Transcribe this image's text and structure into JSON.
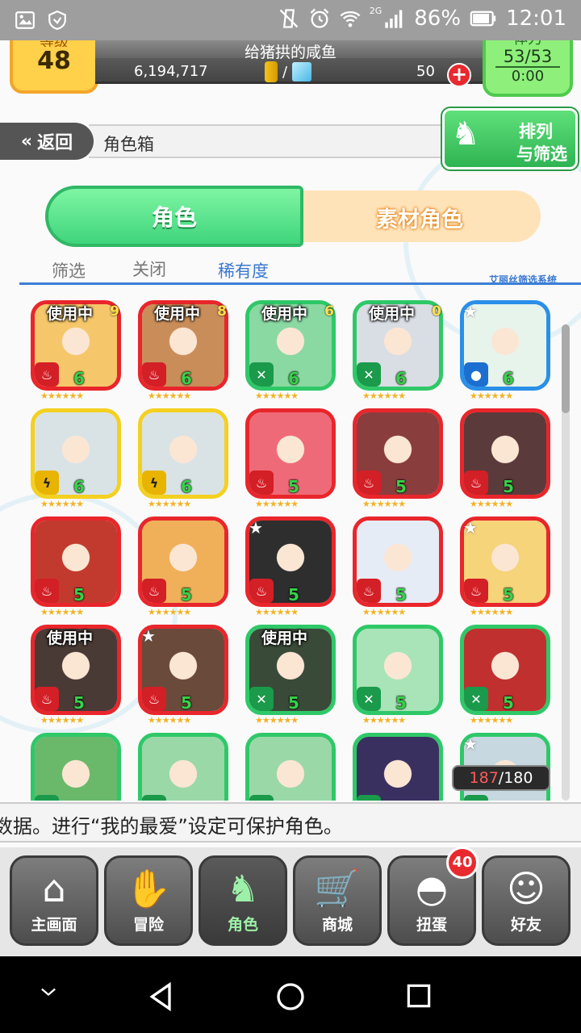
{
  "status_bar": {
    "battery": "86%",
    "time": "12:01",
    "network": "2G"
  },
  "header": {
    "level_label": "等级",
    "level": "48",
    "player_name": "给猪拱的咸鱼",
    "gold": "6,194,717",
    "currency_sep": "/",
    "gems": "50",
    "plus": "+",
    "stamina_label": "体力",
    "stamina": "53/53",
    "stamina_timer": "0:00"
  },
  "nav": {
    "back_label": "返回",
    "page_title": "角色箱",
    "sort_line1": "排列",
    "sort_line2": "与筛选"
  },
  "tabs": {
    "characters": "角色",
    "materials": "素材角色"
  },
  "filter": {
    "filter_label": "筛选",
    "filter_state": "关闭",
    "sort_by": "稀有度",
    "system_label": "艾丽丝筛选系统"
  },
  "cards": [
    {
      "attr": "fire",
      "level": "6",
      "inuse": "使用中",
      "corner": "9"
    },
    {
      "attr": "fire",
      "level": "6",
      "inuse": "使用中",
      "corner": "8"
    },
    {
      "attr": "wind",
      "level": "6",
      "inuse": "使用中",
      "corner": "6"
    },
    {
      "attr": "wind",
      "level": "6",
      "inuse": "使用中",
      "corner": "0"
    },
    {
      "attr": "water",
      "level": "6",
      "inuse": "",
      "corner": "",
      "fav": true
    },
    {
      "attr": "thunder",
      "level": "6",
      "inuse": "",
      "corner": ""
    },
    {
      "attr": "thunder",
      "level": "6",
      "inuse": "",
      "corner": ""
    },
    {
      "attr": "fire",
      "level": "5",
      "inuse": "",
      "corner": ""
    },
    {
      "attr": "fire",
      "level": "5",
      "inuse": "",
      "corner": ""
    },
    {
      "attr": "fire",
      "level": "5",
      "inuse": "",
      "corner": ""
    },
    {
      "attr": "fire",
      "level": "5",
      "inuse": "",
      "corner": ""
    },
    {
      "attr": "fire",
      "level": "5",
      "inuse": "",
      "corner": ""
    },
    {
      "attr": "fire",
      "level": "5",
      "inuse": "",
      "corner": "",
      "fav": true
    },
    {
      "attr": "fire",
      "level": "5",
      "inuse": "",
      "corner": ""
    },
    {
      "attr": "fire",
      "level": "5",
      "inuse": "",
      "corner": "",
      "fav": true
    },
    {
      "attr": "fire",
      "level": "5",
      "inuse": "使用中",
      "corner": ""
    },
    {
      "attr": "fire",
      "level": "5",
      "inuse": "",
      "corner": "",
      "fav": true
    },
    {
      "attr": "wind",
      "level": "5",
      "inuse": "使用中",
      "corner": ""
    },
    {
      "attr": "wind",
      "level": "5",
      "inuse": "",
      "corner": ""
    },
    {
      "attr": "wind",
      "level": "5",
      "inuse": "",
      "corner": ""
    },
    {
      "attr": "wind",
      "level": "",
      "inuse": "",
      "corner": ""
    },
    {
      "attr": "wind",
      "level": "",
      "inuse": "",
      "corner": ""
    },
    {
      "attr": "wind",
      "level": "",
      "inuse": "",
      "corner": ""
    },
    {
      "attr": "wind",
      "level": "",
      "inuse": "",
      "corner": ""
    },
    {
      "attr": "wind",
      "level": "",
      "inuse": "",
      "corner": "",
      "fav": true
    }
  ],
  "box_count": {
    "current": "187",
    "max": "/180"
  },
  "ticker": "数据。进行“我的最爱”设定可保护角色。",
  "bottom_nav": [
    {
      "label": "主画面",
      "icon": "home-icon"
    },
    {
      "label": "冒险",
      "icon": "handshake-icon"
    },
    {
      "label": "角色",
      "icon": "bunny-icon"
    },
    {
      "label": "商城",
      "icon": "cart-icon"
    },
    {
      "label": "扭蛋",
      "icon": "egg-icon",
      "badge": "40"
    },
    {
      "label": "好友",
      "icon": "friends-icon"
    }
  ],
  "colors": {
    "fire": "#e8262b",
    "wind": "#2fc868",
    "thunder": "#f4d021",
    "water": "#2a8fe8",
    "accent_green": "#3fd57c"
  }
}
